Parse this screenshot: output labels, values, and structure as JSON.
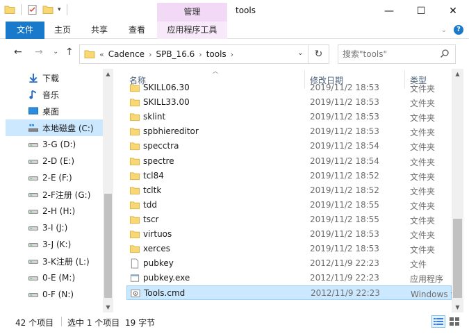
{
  "window": {
    "title": "tools",
    "context_tab_header": "管理",
    "minimize": "—",
    "maximize": "☐",
    "close": "✕"
  },
  "ribbon": {
    "tabs": [
      {
        "label": "文件"
      },
      {
        "label": "主页"
      },
      {
        "label": "共享"
      },
      {
        "label": "查看"
      },
      {
        "label": "应用程序工具"
      }
    ],
    "expand_icon": "chevron-down-icon",
    "accent": "#1979ca",
    "context_color": "#f2d9f5"
  },
  "navigation": {
    "back": "←",
    "forward": "→",
    "recent": "⌄",
    "up": "↑",
    "breadcrumb_overflow": "«",
    "breadcrumb": [
      "Cadence",
      "SPB_16.6",
      "tools"
    ],
    "dropdown": "⌄",
    "refresh": "↻"
  },
  "search": {
    "placeholder": "搜索\"tools\""
  },
  "sidebar": {
    "items": [
      {
        "label": "下载",
        "icon": "download-icon"
      },
      {
        "label": "音乐",
        "icon": "music-icon"
      },
      {
        "label": "桌面",
        "icon": "desktop-icon"
      },
      {
        "label": "本地磁盘 (C:)",
        "icon": "system-drive-icon",
        "selected": true
      },
      {
        "label": "3-G (D:)",
        "icon": "drive-icon"
      },
      {
        "label": "2-D (E:)",
        "icon": "drive-icon"
      },
      {
        "label": "2-E (F:)",
        "icon": "drive-icon"
      },
      {
        "label": "2-F注册 (G:)",
        "icon": "drive-icon"
      },
      {
        "label": "2-H (H:)",
        "icon": "drive-icon"
      },
      {
        "label": "3-I (J:)",
        "icon": "drive-icon"
      },
      {
        "label": "3-J (K:)",
        "icon": "drive-icon"
      },
      {
        "label": "3-K注册 (L:)",
        "icon": "drive-icon"
      },
      {
        "label": "0-E (M:)",
        "icon": "drive-icon"
      },
      {
        "label": "0-F (N:)",
        "icon": "drive-icon"
      }
    ]
  },
  "columns": {
    "name": "名称",
    "date": "修改日期",
    "type": "类型"
  },
  "files": [
    {
      "name": "SKILL06.30",
      "date": "2019/11/2 18:53",
      "type": "文件夹",
      "icon": "folder-icon"
    },
    {
      "name": "SKILL33.00",
      "date": "2019/11/2 18:53",
      "type": "文件夹",
      "icon": "folder-icon"
    },
    {
      "name": "sklint",
      "date": "2019/11/2 18:53",
      "type": "文件夹",
      "icon": "folder-icon"
    },
    {
      "name": "spbhiereditor",
      "date": "2019/11/2 18:53",
      "type": "文件夹",
      "icon": "folder-icon"
    },
    {
      "name": "specctra",
      "date": "2019/11/2 18:54",
      "type": "文件夹",
      "icon": "folder-icon"
    },
    {
      "name": "spectre",
      "date": "2019/11/2 18:54",
      "type": "文件夹",
      "icon": "folder-icon"
    },
    {
      "name": "tcl84",
      "date": "2019/11/2 18:52",
      "type": "文件夹",
      "icon": "folder-icon"
    },
    {
      "name": "tcltk",
      "date": "2019/11/2 18:52",
      "type": "文件夹",
      "icon": "folder-icon"
    },
    {
      "name": "tdd",
      "date": "2019/11/2 18:55",
      "type": "文件夹",
      "icon": "folder-icon"
    },
    {
      "name": "tscr",
      "date": "2019/11/2 18:55",
      "type": "文件夹",
      "icon": "folder-icon"
    },
    {
      "name": "virtuos",
      "date": "2019/11/2 18:53",
      "type": "文件夹",
      "icon": "folder-icon"
    },
    {
      "name": "xerces",
      "date": "2019/11/2 18:53",
      "type": "文件夹",
      "icon": "folder-icon"
    },
    {
      "name": "pubkey",
      "date": "2012/11/9 22:23",
      "type": "文件",
      "icon": "file-icon"
    },
    {
      "name": "pubkey.exe",
      "date": "2012/11/9 22:23",
      "type": "应用程序",
      "icon": "exe-icon"
    },
    {
      "name": "Tools.cmd",
      "date": "2012/11/9 22:23",
      "type": "Windows 命令脚本",
      "icon": "cmd-icon",
      "selected": true
    }
  ],
  "status": {
    "count": "42 个项目",
    "selection": "选中 1 个项目",
    "size": "19 字节"
  }
}
